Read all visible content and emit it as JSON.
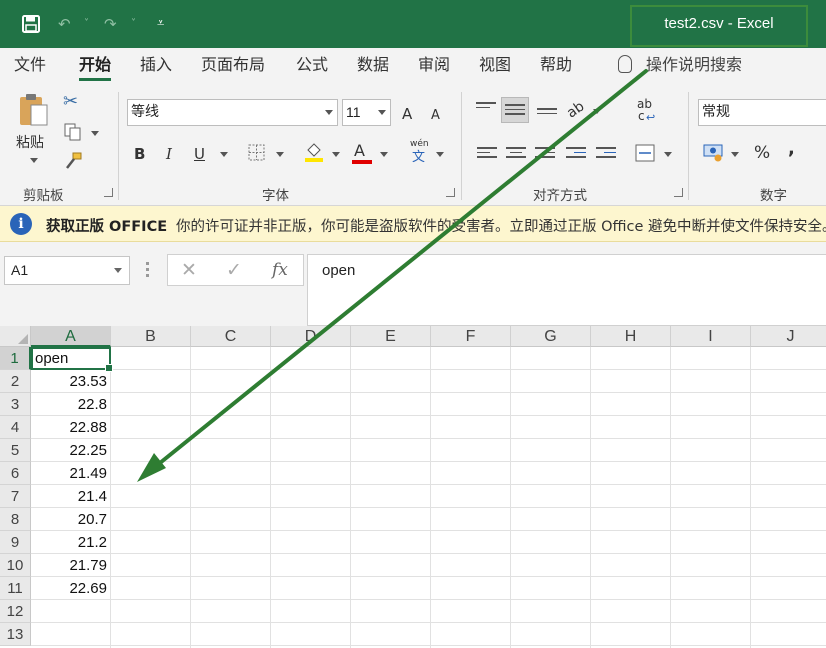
{
  "quick_access": {
    "save_icon": "save-icon",
    "undo_icon": "undo-icon",
    "redo_icon": "redo-icon",
    "customize_icon": "customize-qat-icon"
  },
  "window": {
    "title": "test2.csv  -  Excel"
  },
  "menu": {
    "tabs": [
      "文件",
      "开始",
      "插入",
      "页面布局",
      "公式",
      "数据",
      "审阅",
      "视图",
      "帮助"
    ],
    "active": "开始",
    "tell_me": "操作说明搜索"
  },
  "ribbon": {
    "clipboard": {
      "paste": "粘贴",
      "group": "剪贴板"
    },
    "font": {
      "name": "等线",
      "size": "11",
      "grow": "A",
      "shrink": "A",
      "bold": "B",
      "italic": "I",
      "underline": "U",
      "font_color": "A",
      "phonetic_top": "wén",
      "phonetic_bottom": "文",
      "group": "字体"
    },
    "alignment": {
      "wrap_top": "ab",
      "wrap_bottom": "c",
      "group": "对齐方式"
    },
    "number": {
      "format": "常规",
      "percent": "%",
      "comma": ",",
      "group": "数字"
    }
  },
  "notice": {
    "icon": "i",
    "title": "获取正版 OFFICE",
    "message": "你的许可证并非正版，你可能是盗版软件的受害者。立即通过正版 Office 避免中断并使文件保持安全。"
  },
  "formula_bar": {
    "name_box": "A1",
    "cancel": "✕",
    "enter": "✓",
    "fx": "fx",
    "content": "open"
  },
  "sheet": {
    "columns": [
      "A",
      "B",
      "C",
      "D",
      "E",
      "F",
      "G",
      "H",
      "I",
      "J"
    ],
    "rows": [
      "1",
      "2",
      "3",
      "4",
      "5",
      "6",
      "7",
      "8",
      "9",
      "10",
      "11",
      "12",
      "13"
    ],
    "selected_cell": "A1",
    "column_a": [
      "open",
      "23.53",
      "22.8",
      "22.88",
      "22.25",
      "21.49",
      "21.4",
      "20.7",
      "21.2",
      "21.79",
      "22.69",
      "",
      ""
    ]
  },
  "colors": {
    "excel_green": "#217346",
    "annotation_arrow": "#2e7d32",
    "notice_bg": "#fdf6cf"
  }
}
